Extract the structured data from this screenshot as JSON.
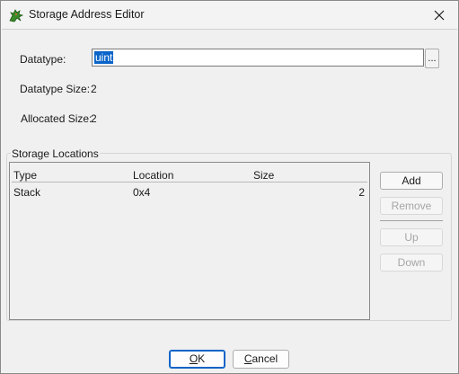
{
  "window": {
    "title": "Storage Address Editor"
  },
  "icons": {
    "app": "dragon-icon",
    "close": "close-icon"
  },
  "fields": {
    "datatype_label": "Datatype:",
    "datatype_value": "uint",
    "browse_label": "...",
    "datatype_size_label": "Datatype Size:",
    "datatype_size_value": "2",
    "allocated_size_label": "Allocated Size:",
    "allocated_size_value": "2"
  },
  "storage": {
    "group_title": "Storage Locations",
    "columns": [
      "Type",
      "Location",
      "Size"
    ],
    "rows": [
      {
        "type": "Stack",
        "location": "0x4",
        "size": "2"
      }
    ],
    "buttons": {
      "add": "Add",
      "remove": "Remove",
      "up": "Up",
      "down": "Down"
    }
  },
  "footer": {
    "ok_mnemonic": "O",
    "ok_rest": "K",
    "cancel_mnemonic": "C",
    "cancel_rest": "ancel"
  },
  "colors": {
    "selection": "#0a64c8"
  }
}
